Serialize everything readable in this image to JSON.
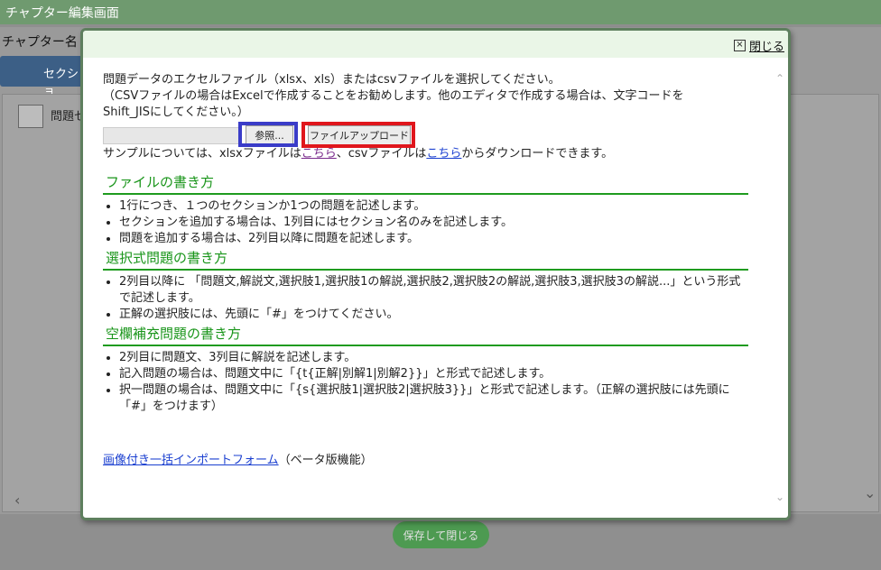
{
  "window": {
    "title": "チャプター編集画面"
  },
  "background": {
    "chapter_label": "チャプター名",
    "tab_label": "セクショ",
    "item_label": "問題セ",
    "save_button": "保存して閉じる"
  },
  "modal": {
    "close_label": "閉じる",
    "intro_line1": "問題データのエクセルファイル（xlsx、xls）またはcsvファイルを選択してください。",
    "intro_line2": "（CSVファイルの場合はExcelで作成することをお勧めします。他のエディタで作成する場合は、文字コードを",
    "intro_line3": "Shift_JISにしてください。）",
    "browse_button": "参照...",
    "upload_button": "ファイルアップロード",
    "sample": {
      "prefix": "サンプルについては、xlsxファイルは",
      "link1": "こちら",
      "middle": "、csvファイルは",
      "link2": "こちら",
      "suffix": "からダウンロードできます。"
    },
    "sections": [
      {
        "title": "ファイルの書き方",
        "items": [
          "1行につき、１つのセクションか1つの問題を記述します。",
          "セクションを追加する場合は、1列目にはセクション名のみを記述します。",
          "問題を追加する場合は、2列目以降に問題を記述します。"
        ]
      },
      {
        "title": "選択式問題の書き方",
        "items": [
          "2列目以降に 「問題文,解説文,選択肢1,選択肢1の解説,選択肢2,選択肢2の解説,選択肢3,選択肢3の解説...」という形式で記述します。",
          "正解の選択肢には、先頭に「#」をつけてください。"
        ]
      },
      {
        "title": "空欄補充問題の書き方",
        "items": [
          "2列目に問題文、3列目に解説を記述します。",
          "記入問題の場合は、問題文中に「{t{正解|別解1|別解2}}」と形式で記述します。",
          "択一問題の場合は、問題文中に「{s{選択肢1|選択肢2|選択肢3}}」と形式で記述します。（正解の選択肢には先頭に「#」をつけます）"
        ]
      }
    ],
    "import_link": "画像付き一括インポートフォーム",
    "import_note": "（ベータ版機能）"
  }
}
